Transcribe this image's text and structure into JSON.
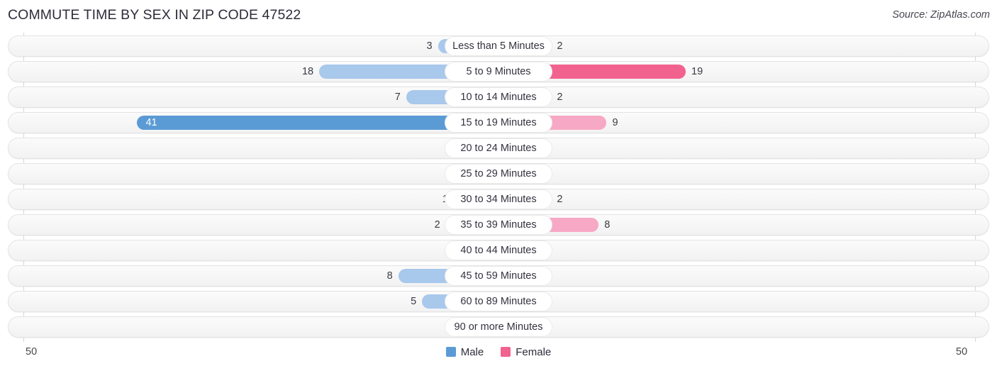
{
  "header": {
    "title": "COMMUTE TIME BY SEX IN ZIP CODE 47522",
    "source": "Source: ZipAtlas.com"
  },
  "legend": {
    "items": [
      {
        "label": "Male",
        "color": "#5B9BD5"
      },
      {
        "label": "Female",
        "color": "#F2628F"
      }
    ]
  },
  "axis": {
    "left_label": "50",
    "right_label": "50"
  },
  "colors": {
    "male_strong": "#5B9BD5",
    "male_light": "#A8C8EC",
    "female_strong": "#F2628F",
    "female_light": "#F7A8C4",
    "track_border": "#e3e3e3",
    "gridline": "#d8d8d8"
  },
  "chart_data": {
    "type": "bar",
    "subtype": "diverging-bidirectional",
    "title": "COMMUTE TIME BY SEX IN ZIP CODE 47522",
    "xlabel": "",
    "ylabel": "",
    "xlim": [
      -50,
      50
    ],
    "axis_max": 50,
    "grid": true,
    "legend_position": "bottom-center",
    "categories": [
      "Less than 5 Minutes",
      "5 to 9 Minutes",
      "10 to 14 Minutes",
      "15 to 19 Minutes",
      "20 to 24 Minutes",
      "25 to 29 Minutes",
      "30 to 34 Minutes",
      "35 to 39 Minutes",
      "40 to 44 Minutes",
      "45 to 59 Minutes",
      "60 to 89 Minutes",
      "90 or more Minutes"
    ],
    "series": [
      {
        "name": "Male",
        "direction": "left",
        "values": [
          3,
          18,
          7,
          41,
          0,
          0,
          1,
          2,
          0,
          8,
          5,
          0
        ]
      },
      {
        "name": "Female",
        "direction": "right",
        "values": [
          2,
          19,
          2,
          9,
          0,
          0,
          2,
          8,
          0,
          0,
          0,
          0
        ]
      }
    ]
  },
  "rows": [
    {
      "category": "Less than 5 Minutes",
      "male": "3",
      "female": "2"
    },
    {
      "category": "5 to 9 Minutes",
      "male": "18",
      "female": "19"
    },
    {
      "category": "10 to 14 Minutes",
      "male": "7",
      "female": "2"
    },
    {
      "category": "15 to 19 Minutes",
      "male": "41",
      "female": "9"
    },
    {
      "category": "20 to 24 Minutes",
      "male": "0",
      "female": "0"
    },
    {
      "category": "25 to 29 Minutes",
      "male": "0",
      "female": "0"
    },
    {
      "category": "30 to 34 Minutes",
      "male": "1",
      "female": "2"
    },
    {
      "category": "35 to 39 Minutes",
      "male": "2",
      "female": "8"
    },
    {
      "category": "40 to 44 Minutes",
      "male": "0",
      "female": "0"
    },
    {
      "category": "45 to 59 Minutes",
      "male": "8",
      "female": "0"
    },
    {
      "category": "60 to 89 Minutes",
      "male": "5",
      "female": "0"
    },
    {
      "category": "90 or more Minutes",
      "male": "0",
      "female": "0"
    }
  ]
}
